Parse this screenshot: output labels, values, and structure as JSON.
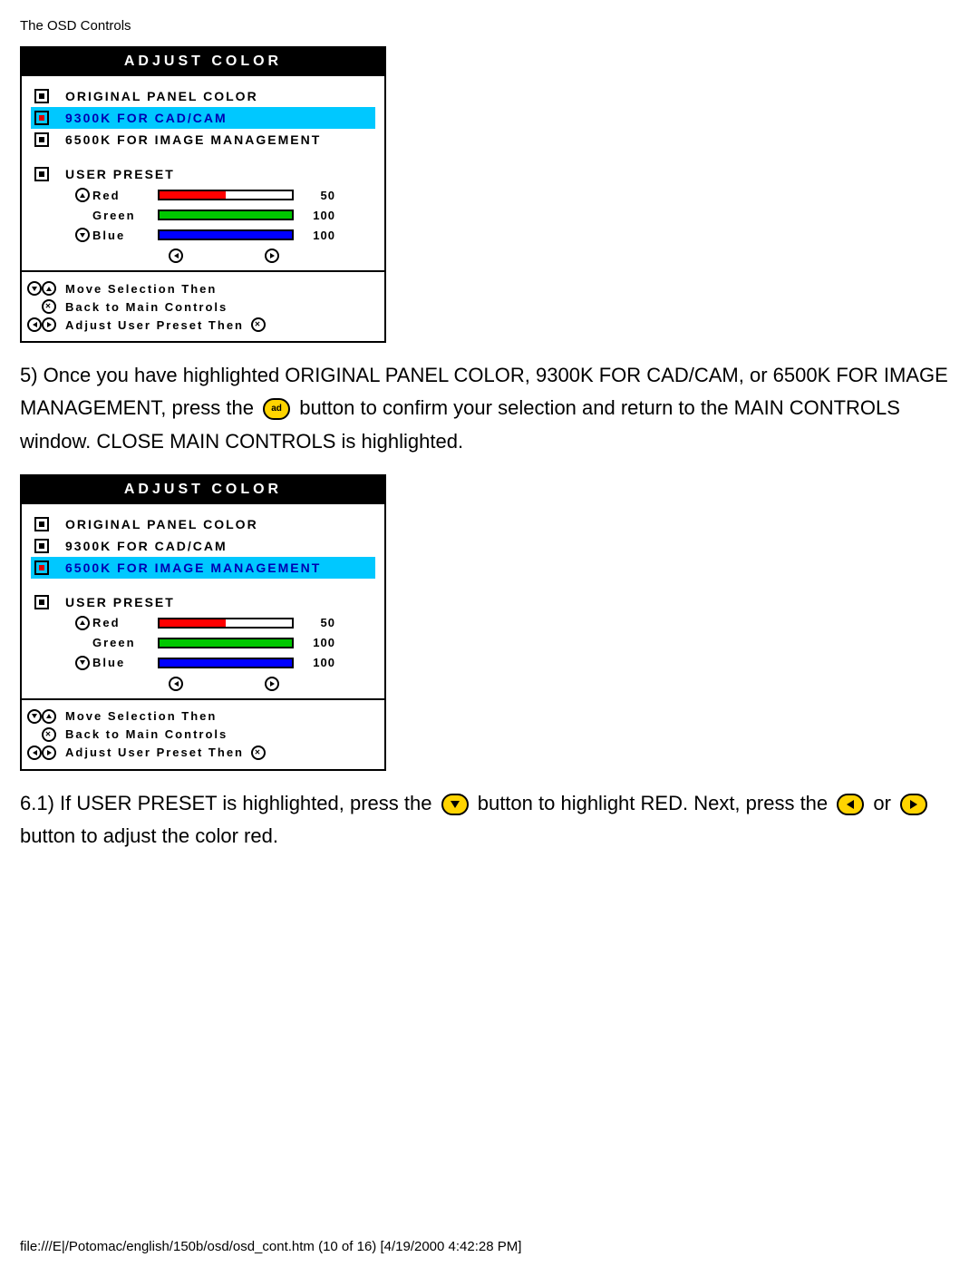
{
  "page_header": "The OSD Controls",
  "osd_title": "Adjust Color",
  "options": {
    "original": "Original Panel Color",
    "k9300": "9300K for CAD/CAM",
    "k6500": "6500K for Image Management",
    "user_preset": "User Preset"
  },
  "rgb": {
    "red": {
      "label": "Red",
      "value": 50
    },
    "green": {
      "label": "Green",
      "value": 100
    },
    "blue": {
      "label": "Blue",
      "value": 100
    }
  },
  "hints": {
    "move": "Move Selection Then",
    "back": "Back to Main Controls",
    "adjust": "Adjust User Preset Then"
  },
  "panel1_selected": "k9300",
  "panel2_selected": "k6500",
  "step5": {
    "a": "5) Once you have highlighted ORIGINAL PANEL COLOR, 9300K FOR CAD/CAM, or 6500K FOR IMAGE MANAGEMENT, press the ",
    "b": " button to confirm your selection and return to the MAIN CONTROLS window. CLOSE MAIN CONTROLS is highlighted."
  },
  "step6": {
    "a": "6.1) If USER PRESET is highlighted, press the ",
    "b": " button to highlight RED. Next, press the ",
    "c": " or ",
    "d": " button to adjust the color red."
  },
  "ok_label": "ad",
  "footer": "file:///E|/Potomac/english/150b/osd/osd_cont.htm (10 of 16) [4/19/2000 4:42:28 PM]"
}
